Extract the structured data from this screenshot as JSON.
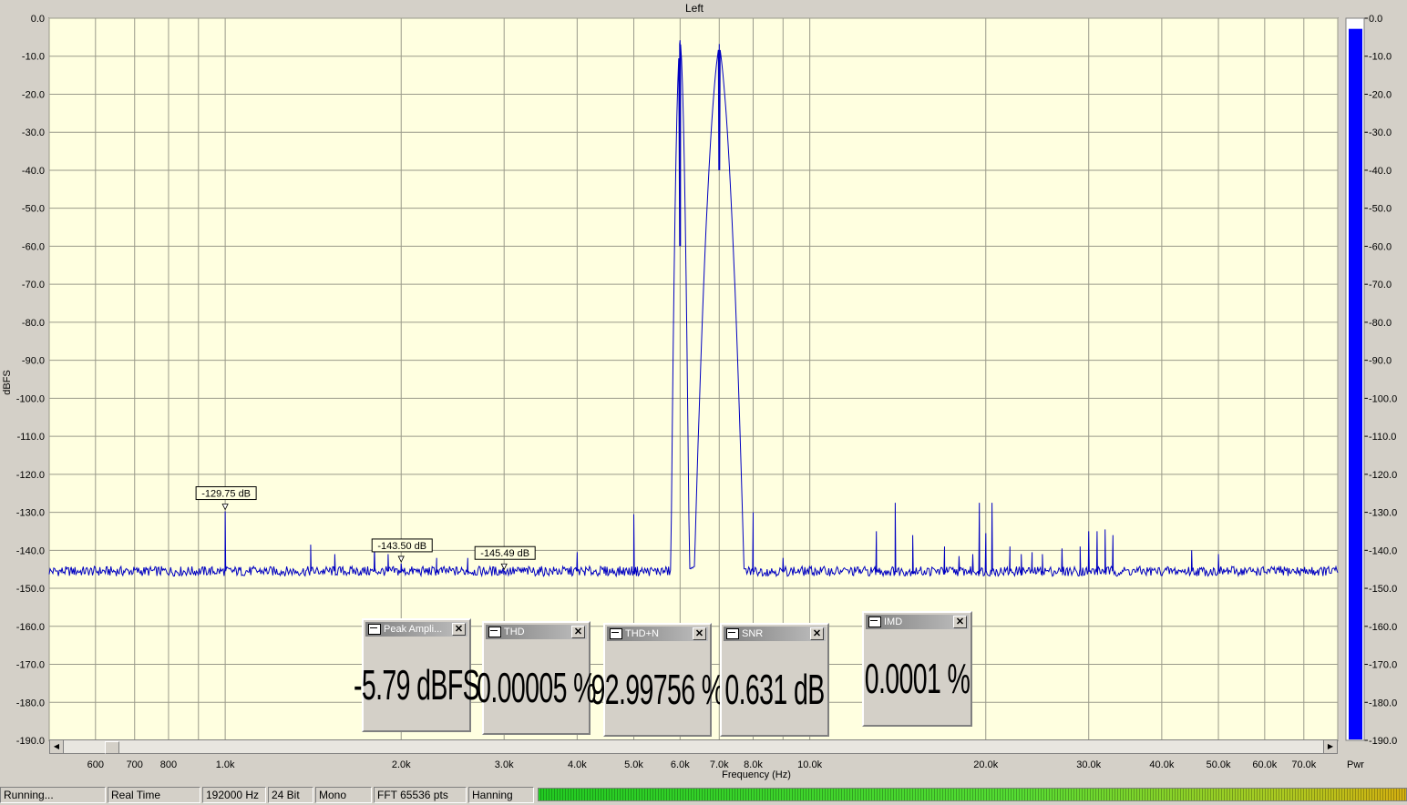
{
  "window": {
    "title": "Left"
  },
  "status": {
    "state": "Running...",
    "mode": "Real Time",
    "rate": "192000 Hz",
    "bits": "24 Bit",
    "channels": "Mono",
    "fft": "FFT 65536 pts",
    "window_fn": "Hanning"
  },
  "meters": [
    {
      "title": "Peak Ampli...",
      "value": "-5.79 dBFS"
    },
    {
      "title": "THD",
      "value": "0.00005 %"
    },
    {
      "title": "THD+N",
      "value": "92.99756 %"
    },
    {
      "title": "SNR",
      "value": "0.631 dB"
    },
    {
      "title": "IMD",
      "value": "0.0001 %"
    }
  ],
  "power_label": "Pwr",
  "power_level_dBFS": -2.8,
  "colors": {
    "plot_bg": "#ffffe0",
    "trace": "#0000c0",
    "grid": "#9a9a8a",
    "power_bar": "#0000ff"
  },
  "chart_data": {
    "type": "line",
    "xlabel": "Frequency (Hz)",
    "ylabel": "dBFS",
    "xscale": "log",
    "xlim": [
      500,
      80000
    ],
    "ylim": [
      -190,
      0
    ],
    "y_ticks": [
      "0.0",
      "-10.0",
      "-20.0",
      "-30.0",
      "-40.0",
      "-50.0",
      "-60.0",
      "-70.0",
      "-80.0",
      "-90.0",
      "-100.0",
      "-110.0",
      "-120.0",
      "-130.0",
      "-140.0",
      "-150.0",
      "-160.0",
      "-170.0",
      "-180.0",
      "-190.0"
    ],
    "x_ticks": [
      {
        "v": 600,
        "label": "600"
      },
      {
        "v": 700,
        "label": "700"
      },
      {
        "v": 800,
        "label": "800"
      },
      {
        "v": 1000,
        "label": "1.0k"
      },
      {
        "v": 2000,
        "label": "2.0k"
      },
      {
        "v": 3000,
        "label": "3.0k"
      },
      {
        "v": 4000,
        "label": "4.0k"
      },
      {
        "v": 5000,
        "label": "5.0k"
      },
      {
        "v": 6000,
        "label": "6.0k"
      },
      {
        "v": 7000,
        "label": "7.0k"
      },
      {
        "v": 8000,
        "label": "8.0k"
      },
      {
        "v": 10000,
        "label": "10.0k"
      },
      {
        "v": 20000,
        "label": "20.0k"
      },
      {
        "v": 30000,
        "label": "30.0k"
      },
      {
        "v": 40000,
        "label": "40.0k"
      },
      {
        "v": 50000,
        "label": "50.0k"
      },
      {
        "v": 60000,
        "label": "60.0k"
      },
      {
        "v": 70000,
        "label": "70.0k"
      }
    ],
    "grid": true,
    "noise_floor": -145.5,
    "series": [
      {
        "peaks": [
          [
            6000,
            -5.8
          ],
          [
            7000,
            -6.8
          ],
          [
            1000,
            -129.75
          ],
          [
            1400,
            -138.5
          ],
          [
            1540,
            -141
          ],
          [
            1800,
            -139
          ],
          [
            1900,
            -141
          ],
          [
            2000,
            -143.5
          ],
          [
            2300,
            -142
          ],
          [
            2600,
            -142
          ],
          [
            3000,
            -145.49
          ],
          [
            4000,
            -140.5
          ],
          [
            5000,
            -130.5
          ],
          [
            8000,
            -130
          ],
          [
            9000,
            -142
          ],
          [
            13000,
            -135
          ],
          [
            14000,
            -127.5
          ],
          [
            15000,
            -136
          ],
          [
            17000,
            -139
          ],
          [
            18000,
            -141.5
          ],
          [
            19000,
            -141
          ],
          [
            19500,
            -127.5
          ],
          [
            20000,
            -135.5
          ],
          [
            20500,
            -127.5
          ],
          [
            22000,
            -139
          ],
          [
            23000,
            -141
          ],
          [
            24000,
            -140.5
          ],
          [
            25000,
            -141
          ],
          [
            27000,
            -139.5
          ],
          [
            29000,
            -139
          ],
          [
            30000,
            -135
          ],
          [
            31000,
            -135
          ],
          [
            32000,
            -134.5
          ],
          [
            33000,
            -136
          ],
          [
            45000,
            -140
          ],
          [
            50000,
            -141
          ]
        ]
      }
    ],
    "annotations": [
      {
        "x": 1000,
        "y": -129.75,
        "label": "-129.75 dB"
      },
      {
        "x": 2000,
        "y": -143.5,
        "label": "-143.50 dB"
      },
      {
        "x": 3000,
        "y": -145.49,
        "label": "-145.49 dB"
      }
    ]
  }
}
